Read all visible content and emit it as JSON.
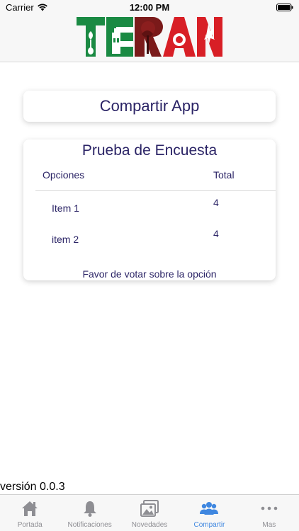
{
  "status_bar": {
    "carrier": "Carrier",
    "time": "12:00 PM"
  },
  "header": {
    "logo_text": "TERAN"
  },
  "share": {
    "label": "Compartir App"
  },
  "survey": {
    "title": "Prueba de Encuesta",
    "columns": {
      "options": "Opciones",
      "total": "Total"
    },
    "rows": [
      {
        "label": "Item 1",
        "value": "4"
      },
      {
        "label": "item 2",
        "value": "4"
      }
    ],
    "footnote": "Favor de votar sobre la opción"
  },
  "version": "versión 0.0.3",
  "tabbar": {
    "tabs": [
      {
        "label": "Portada",
        "icon": "home-icon"
      },
      {
        "label": "Notificaciones",
        "icon": "bell-icon"
      },
      {
        "label": "Novedades",
        "icon": "photos-icon"
      },
      {
        "label": "Compartir",
        "icon": "people-icon",
        "active": true
      },
      {
        "label": "Mas",
        "icon": "more-icon"
      }
    ]
  },
  "colors": {
    "accent": "#2b2466",
    "tab_active": "#3f87e0",
    "logo_green": "#1a8a43",
    "logo_red": "#d81f26"
  }
}
